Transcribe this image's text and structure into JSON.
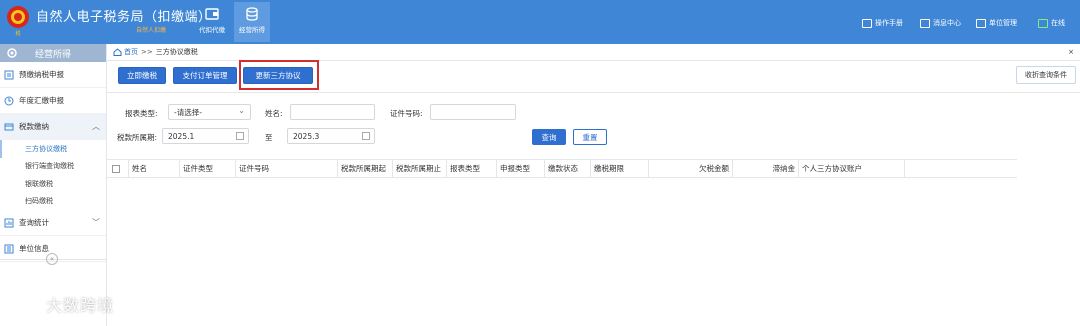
{
  "header": {
    "title": "自然人电子税务局（扣缴端）",
    "subtitle": "自然人扣缴",
    "nav": [
      {
        "label": "代扣代缴",
        "icon": "wallet-icon",
        "active": false
      },
      {
        "label": "经营所得",
        "icon": "coins-icon",
        "active": true
      }
    ],
    "utilities": [
      {
        "label": "操作手册",
        "icon": "manual-icon"
      },
      {
        "label": "消息中心",
        "icon": "message-icon"
      },
      {
        "label": "单位管理",
        "icon": "building-icon"
      },
      {
        "label": "在线",
        "icon": "online-icon"
      }
    ],
    "colors": {
      "bar": "#3f86d6",
      "active_nav": "#5f9be0"
    }
  },
  "sidebar": {
    "header": "经营所得",
    "items": [
      {
        "label": "预缴纳税申报",
        "icon": "declare-icon"
      },
      {
        "label": "年度汇缴申报",
        "icon": "annual-icon"
      },
      {
        "label": "税款缴纳",
        "icon": "tax-payment-icon",
        "expanded": true
      }
    ],
    "sub_items": [
      {
        "label": "三方协议缴税",
        "active": true
      },
      {
        "label": "银行端查询缴税",
        "active": false
      },
      {
        "label": "银联缴税",
        "active": false
      },
      {
        "label": "扫码缴税",
        "active": false
      }
    ],
    "bottom_items": [
      {
        "label": "查询统计",
        "icon": "stats-icon",
        "has_chevron": true
      },
      {
        "label": "单位信息",
        "icon": "unit-info-icon",
        "has_chevron": false
      }
    ],
    "collapse_glyph": "«"
  },
  "breadcrumb": {
    "home": "首页",
    "sep": ">>",
    "current": "三方协议缴税",
    "close": "×"
  },
  "toolbar": {
    "pay_now": "立即缴税",
    "order_mgmt": "支付订单管理",
    "update_agreement": "更新三方协议",
    "collapse_query": "收折查询条件"
  },
  "filters": {
    "report_type_label": "报表类型:",
    "report_type_value": "-请选择-",
    "name_label": "姓名:",
    "name_value": "",
    "id_label": "证件号码:",
    "id_value": "",
    "period_label": "税款所属期:",
    "period_start": "2025.1",
    "period_to": "至",
    "period_end": "2025.3",
    "query": "查询",
    "reset": "重置"
  },
  "table": {
    "columns": [
      "姓名",
      "证件类型",
      "证件号码",
      "税款所属期起",
      "税款所属期止",
      "报表类型",
      "申报类型",
      "缴款状态",
      "缴税期限",
      "欠税金额",
      "滞纳金",
      "个人三方协议账户"
    ]
  },
  "watermark": "大数跨境"
}
